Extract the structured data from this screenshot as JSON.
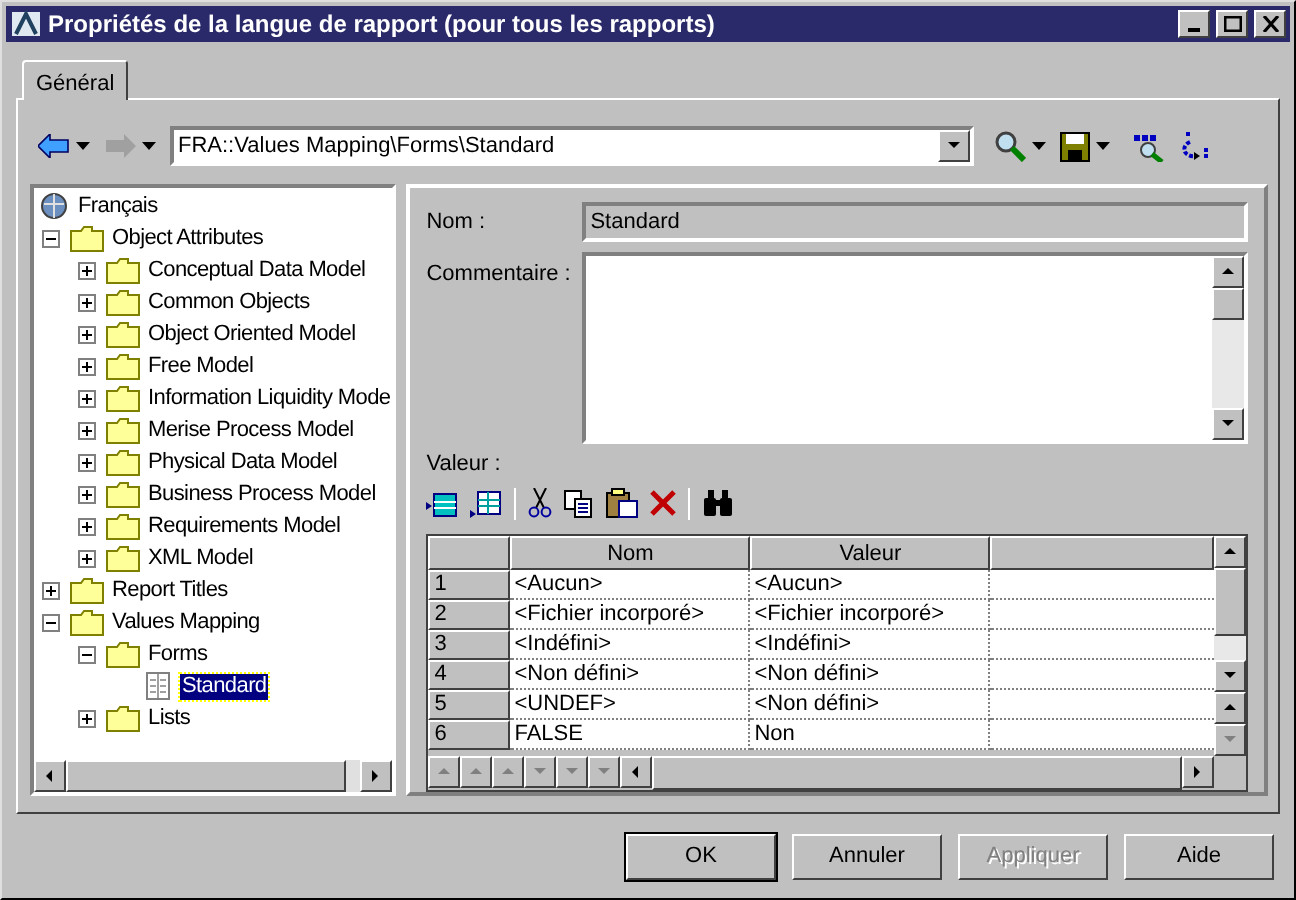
{
  "window": {
    "title": "Propriétés de la langue de rapport (pour tous les rapports)"
  },
  "tabs": [
    {
      "label": "Général",
      "selected": true
    }
  ],
  "toolbar": {
    "path": "FRA::Values Mapping\\Forms\\Standard",
    "forward_disabled": true
  },
  "tree": [
    {
      "label": "Français",
      "kind": "root",
      "selected": false,
      "children": [
        {
          "label": "Object Attributes",
          "kind": "folder",
          "expanded": true,
          "selected": false,
          "children": [
            {
              "label": "Conceptual Data Model",
              "kind": "folder",
              "expanded": false,
              "selected": false
            },
            {
              "label": "Common Objects",
              "kind": "folder",
              "expanded": false,
              "selected": false
            },
            {
              "label": "Object Oriented Model",
              "kind": "folder",
              "expanded": false,
              "selected": false
            },
            {
              "label": "Free Model",
              "kind": "folder",
              "expanded": false,
              "selected": false
            },
            {
              "label": "Information Liquidity Mode",
              "kind": "folder",
              "expanded": false,
              "selected": false
            },
            {
              "label": "Merise Process Model",
              "kind": "folder",
              "expanded": false,
              "selected": false
            },
            {
              "label": "Physical Data Model",
              "kind": "folder",
              "expanded": false,
              "selected": false
            },
            {
              "label": "Business Process Model",
              "kind": "folder",
              "expanded": false,
              "selected": false
            },
            {
              "label": "Requirements Model",
              "kind": "folder",
              "expanded": false,
              "selected": false
            },
            {
              "label": "XML Model",
              "kind": "folder",
              "expanded": false,
              "selected": false
            }
          ]
        },
        {
          "label": "Report Titles",
          "kind": "folder",
          "expanded": false,
          "selected": false
        },
        {
          "label": "Values Mapping",
          "kind": "folder",
          "expanded": true,
          "selected": false,
          "children": [
            {
              "label": "Forms",
              "kind": "folder",
              "expanded": true,
              "selected": false,
              "children": [
                {
                  "label": "Standard",
                  "kind": "form",
                  "selected": true
                }
              ]
            },
            {
              "label": "Lists",
              "kind": "folder",
              "expanded": false,
              "selected": false
            }
          ]
        }
      ]
    }
  ],
  "form": {
    "name_label": "Nom :",
    "name_value": "Standard",
    "comment_label": "Commentaire :",
    "value_label": "Valeur :"
  },
  "table": {
    "columns": [
      "Nom",
      "Valeur"
    ],
    "rows": [
      {
        "number": "1",
        "nom": "<Aucun>",
        "valeur": "<Aucun>"
      },
      {
        "number": "2",
        "nom": "<Fichier incorporé>",
        "valeur": "<Fichier incorporé>"
      },
      {
        "number": "3",
        "nom": "<Indéfini>",
        "valeur": "<Indéfini>"
      },
      {
        "number": "4",
        "nom": "<Non défini>",
        "valeur": "<Non défini>"
      },
      {
        "number": "5",
        "nom": "<UNDEF>",
        "valeur": "<Non défini>"
      },
      {
        "number": "6",
        "nom": "FALSE",
        "valeur": "Non"
      }
    ]
  },
  "buttons": [
    {
      "label": "OK",
      "default": true,
      "disabled": false
    },
    {
      "label": "Annuler",
      "default": false,
      "disabled": false
    },
    {
      "label": "Appliquer",
      "default": false,
      "disabled": true
    },
    {
      "label": "Aide",
      "default": false,
      "disabled": false
    }
  ]
}
